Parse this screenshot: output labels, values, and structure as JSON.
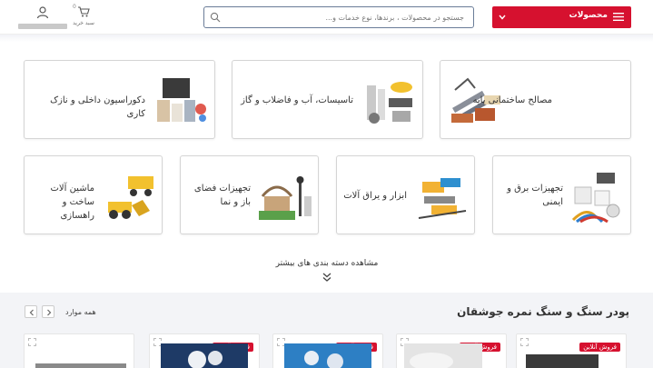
{
  "header": {
    "menu_label": "محصولات",
    "search_placeholder": "جستجو در محصولات ، برندها، نوع خدمات و...",
    "cart_label": "سبد خرید",
    "cart_count": "0",
    "accent_color": "#d6112f"
  },
  "categories": [
    {
      "label": "مصالح ساختمانی پایه",
      "icon": "construction-materials-image"
    },
    {
      "label": "تاسیسات، آب و فاضلاب و گاز",
      "icon": "plumbing-image"
    },
    {
      "label": "دکوراسیون داخلی و نازک کاری",
      "icon": "interior-decoration-image"
    },
    {
      "label": "تجهیزات برق و ایمنی",
      "icon": "electrical-safety-image"
    },
    {
      "label": "ابزار و یراق آلات",
      "icon": "tools-image"
    },
    {
      "label": "تجهیزات فضای باز و نما",
      "icon": "outdoor-equipment-image"
    },
    {
      "label": "ماشین آلات ساخت و راهسازی",
      "icon": "construction-machinery-image"
    }
  ],
  "more_categories_label": "مشاهده دسته بندی های بیشتر",
  "products_section": {
    "title": "پودر سنگ و سنگ نمره جوشقان",
    "view_all_label": "همه موارد",
    "badge_label": "فروش آنلاین",
    "items_count_visible": 5
  }
}
